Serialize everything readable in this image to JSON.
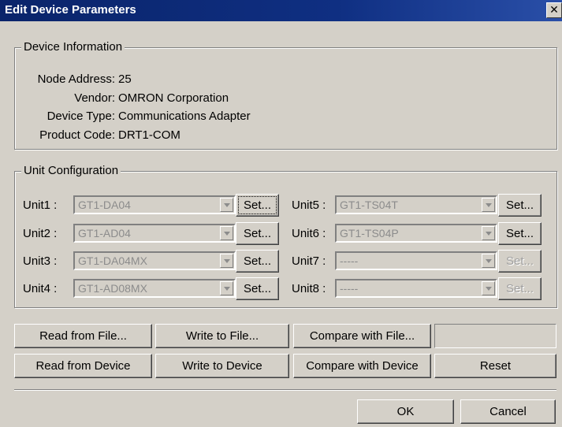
{
  "title": "Edit Device Parameters",
  "close_glyph": "✕",
  "device_info": {
    "group_title": "Device Information",
    "node_address_label": "Node Address:",
    "node_address": "25",
    "vendor_label": "Vendor:",
    "vendor": "OMRON Corporation",
    "device_type_label": "Device Type:",
    "device_type": "Communications Adapter",
    "product_code_label": "Product Code:",
    "product_code": "DRT1-COM"
  },
  "unit_config": {
    "group_title": "Unit Configuration",
    "units": [
      {
        "label": "Unit1 :",
        "value": "GT1-DA04",
        "set": "Set..."
      },
      {
        "label": "Unit2 :",
        "value": "GT1-AD04",
        "set": "Set..."
      },
      {
        "label": "Unit3 :",
        "value": "GT1-DA04MX",
        "set": "Set..."
      },
      {
        "label": "Unit4 :",
        "value": "GT1-AD08MX",
        "set": "Set..."
      },
      {
        "label": "Unit5 :",
        "value": "GT1-TS04T",
        "set": "Set..."
      },
      {
        "label": "Unit6 :",
        "value": "GT1-TS04P",
        "set": "Set..."
      },
      {
        "label": "Unit7 :",
        "value": "-----",
        "set": "Set..."
      },
      {
        "label": "Unit8 :",
        "value": "-----",
        "set": "Set..."
      }
    ]
  },
  "buttons": {
    "read_file": "Read from File...",
    "write_file": "Write to File...",
    "compare_file": "Compare with File...",
    "read_device": "Read from Device",
    "write_device": "Write to Device",
    "compare_device": "Compare with Device",
    "reset": "Reset",
    "ok": "OK",
    "cancel": "Cancel"
  }
}
